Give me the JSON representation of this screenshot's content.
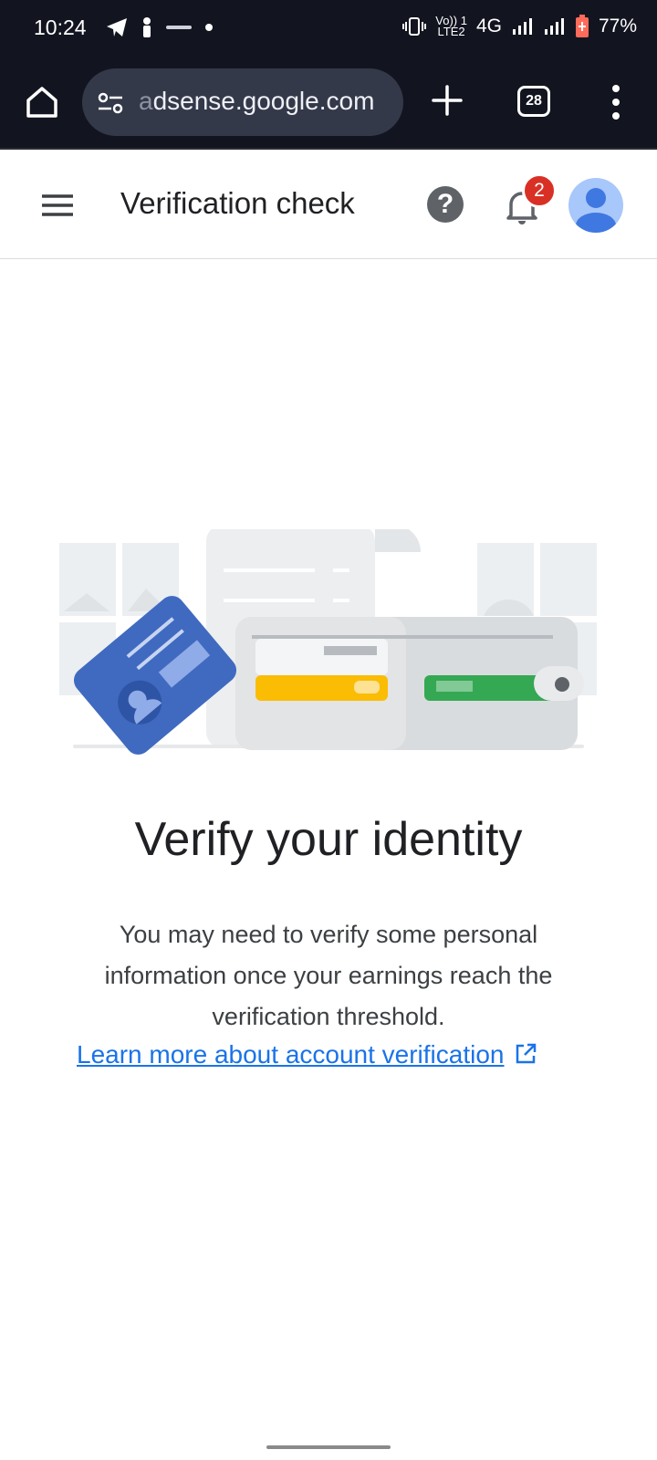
{
  "status_bar": {
    "time": "10:24",
    "network_top": "Vo)) 1",
    "network_bottom": "LTE2",
    "network_type": "4G",
    "battery": "77%",
    "icons": [
      "telegram-icon",
      "notification-icon",
      "misc-icon",
      "dot-icon",
      "vibrate-icon",
      "signal-icon",
      "battery-icon"
    ]
  },
  "browser": {
    "url_faded": "a",
    "url": "dsense.google.com",
    "tab_count": "28"
  },
  "app_bar": {
    "title": "Verification check",
    "help": "?",
    "notifications_count": "2"
  },
  "content": {
    "headline": "Verify your identity",
    "body": "You may need to verify some personal information once your earnings reach the verification threshold.",
    "link": "Learn more about account verification"
  },
  "colors": {
    "status_bg": "#121520",
    "link": "#1a73e8",
    "badge": "#d93025",
    "card_blue": "#3f6ac0",
    "card_yellow": "#fbbc04",
    "card_green": "#34a853"
  }
}
